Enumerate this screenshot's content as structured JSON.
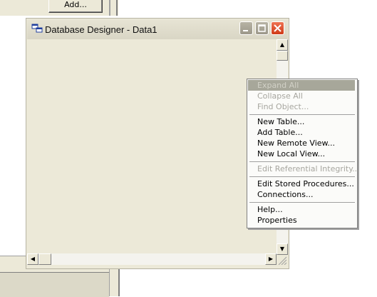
{
  "background": {
    "add_button_label": "Add..."
  },
  "window": {
    "title": "Database Designer - Data1",
    "icon": "database-designer-icon",
    "controls": {
      "minimize": "minimize-icon",
      "maximize": "maximize-icon",
      "close": "close-icon"
    }
  },
  "context_menu": {
    "items": [
      {
        "label": "Expand All",
        "state": "disabled-highlighted"
      },
      {
        "label": "Collapse All",
        "state": "disabled"
      },
      {
        "label": "Find Object...",
        "state": "disabled"
      },
      {
        "label": "New Table...",
        "state": "enabled"
      },
      {
        "label": "Add Table...",
        "state": "enabled"
      },
      {
        "label": "New Remote View...",
        "state": "enabled"
      },
      {
        "label": "New Local View...",
        "state": "enabled"
      },
      {
        "label": "Edit Referential Integrity...",
        "state": "disabled"
      },
      {
        "label": "Edit Stored Procedures...",
        "state": "enabled"
      },
      {
        "label": "Connections...",
        "state": "enabled"
      },
      {
        "label": "Help...",
        "state": "enabled"
      },
      {
        "label": "Properties",
        "state": "enabled"
      }
    ]
  },
  "colors": {
    "close_button": "#d9481f",
    "menu_highlight": "#a7a79a",
    "disabled_text": "#a7a69f"
  }
}
